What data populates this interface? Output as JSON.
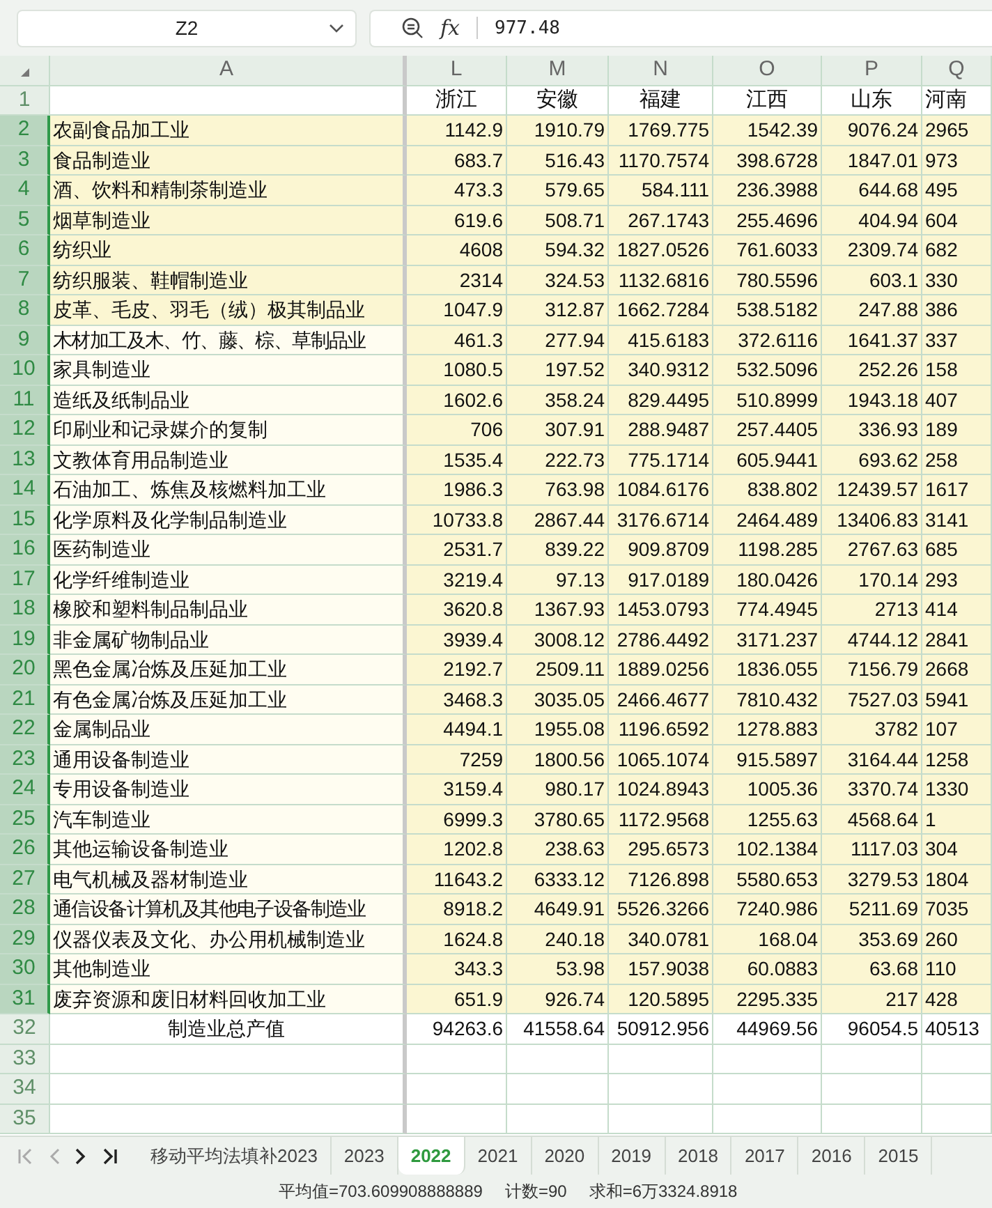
{
  "toolbar": {
    "name_box": "Z2",
    "function_label": "fx",
    "formula": "977.48"
  },
  "columns": [
    {
      "letter": "A",
      "selected": false
    },
    {
      "letter": "L",
      "selected": false
    },
    {
      "letter": "M",
      "selected": false
    },
    {
      "letter": "N",
      "selected": false
    },
    {
      "letter": "O",
      "selected": false
    },
    {
      "letter": "P",
      "selected": false
    },
    {
      "letter": "Q",
      "selected": false
    }
  ],
  "rows": [
    {
      "number": "1",
      "kind": "header",
      "selected": false,
      "values": [
        "浙江",
        "安徽",
        "福建",
        "江西",
        "山东",
        "河南"
      ]
    },
    {
      "number": "2",
      "kind": "data",
      "selected": true,
      "label_highlight": true,
      "label": "农副食品加工业",
      "values": [
        "1142.9",
        "1910.79",
        "1769.775",
        "1542.39",
        "9076.24",
        "2965"
      ]
    },
    {
      "number": "3",
      "kind": "data",
      "selected": true,
      "label_highlight": true,
      "label": "食品制造业",
      "values": [
        "683.7",
        "516.43",
        "1170.7574",
        "398.6728",
        "1847.01",
        "973"
      ]
    },
    {
      "number": "4",
      "kind": "data",
      "selected": true,
      "label_highlight": true,
      "label": "酒、饮料和精制茶制造业",
      "values": [
        "473.3",
        "579.65",
        "584.111",
        "236.3988",
        "644.68",
        "495"
      ]
    },
    {
      "number": "5",
      "kind": "data",
      "selected": true,
      "label_highlight": true,
      "label": "烟草制造业",
      "values": [
        "619.6",
        "508.71",
        "267.1743",
        "255.4696",
        "404.94",
        "604"
      ]
    },
    {
      "number": "6",
      "kind": "data",
      "selected": true,
      "label_highlight": true,
      "label": "纺织业",
      "values": [
        "4608",
        "594.32",
        "1827.0526",
        "761.6033",
        "2309.74",
        "682"
      ]
    },
    {
      "number": "7",
      "kind": "data",
      "selected": true,
      "label_highlight": true,
      "label": "纺织服装、鞋帽制造业",
      "values": [
        "2314",
        "324.53",
        "1132.6816",
        "780.5596",
        "603.1",
        "330"
      ]
    },
    {
      "number": "8",
      "kind": "data",
      "selected": true,
      "label_highlight": true,
      "label": "皮革、毛皮、羽毛（绒）极其制品业",
      "values": [
        "1047.9",
        "312.87",
        "1662.7284",
        "538.5182",
        "247.88",
        "386"
      ]
    },
    {
      "number": "9",
      "kind": "data",
      "selected": true,
      "label_highlight": false,
      "label": "木材加工及木、竹、藤、棕、草制品业",
      "values": [
        "461.3",
        "277.94",
        "415.6183",
        "372.6116",
        "1641.37",
        "337"
      ]
    },
    {
      "number": "10",
      "kind": "data",
      "selected": true,
      "label_highlight": false,
      "label": "家具制造业",
      "values": [
        "1080.5",
        "197.52",
        "340.9312",
        "532.5096",
        "252.26",
        "158"
      ]
    },
    {
      "number": "11",
      "kind": "data",
      "selected": true,
      "label_highlight": false,
      "label": "造纸及纸制品业",
      "values": [
        "1602.6",
        "358.24",
        "829.4495",
        "510.8999",
        "1943.18",
        "407"
      ]
    },
    {
      "number": "12",
      "kind": "data",
      "selected": true,
      "label_highlight": false,
      "label": "印刷业和记录媒介的复制",
      "values": [
        "706",
        "307.91",
        "288.9487",
        "257.4405",
        "336.93",
        "189"
      ]
    },
    {
      "number": "13",
      "kind": "data",
      "selected": true,
      "label_highlight": false,
      "label": "文教体育用品制造业",
      "values": [
        "1535.4",
        "222.73",
        "775.1714",
        "605.9441",
        "693.62",
        "258"
      ]
    },
    {
      "number": "14",
      "kind": "data",
      "selected": true,
      "label_highlight": false,
      "label": "石油加工、炼焦及核燃料加工业",
      "values": [
        "1986.3",
        "763.98",
        "1084.6176",
        "838.802",
        "12439.57",
        "1617"
      ]
    },
    {
      "number": "15",
      "kind": "data",
      "selected": true,
      "label_highlight": false,
      "label": "化学原料及化学制品制造业",
      "values": [
        "10733.8",
        "2867.44",
        "3176.6714",
        "2464.489",
        "13406.83",
        "3141"
      ]
    },
    {
      "number": "16",
      "kind": "data",
      "selected": true,
      "label_highlight": false,
      "label": "医药制造业",
      "values": [
        "2531.7",
        "839.22",
        "909.8709",
        "1198.285",
        "2767.63",
        "685"
      ]
    },
    {
      "number": "17",
      "kind": "data",
      "selected": true,
      "label_highlight": false,
      "label": "化学纤维制造业",
      "values": [
        "3219.4",
        "97.13",
        "917.0189",
        "180.0426",
        "170.14",
        "293"
      ]
    },
    {
      "number": "18",
      "kind": "data",
      "selected": true,
      "label_highlight": false,
      "label": "橡胶和塑料制品制品业",
      "values": [
        "3620.8",
        "1367.93",
        "1453.0793",
        "774.4945",
        "2713",
        "414"
      ]
    },
    {
      "number": "19",
      "kind": "data",
      "selected": true,
      "label_highlight": false,
      "label": "非金属矿物制品业",
      "values": [
        "3939.4",
        "3008.12",
        "2786.4492",
        "3171.237",
        "4744.12",
        "2841"
      ]
    },
    {
      "number": "20",
      "kind": "data",
      "selected": true,
      "label_highlight": false,
      "label": "黑色金属冶炼及压延加工业",
      "values": [
        "2192.7",
        "2509.11",
        "1889.0256",
        "1836.055",
        "7156.79",
        "2668"
      ]
    },
    {
      "number": "21",
      "kind": "data",
      "selected": true,
      "label_highlight": false,
      "label": "有色金属冶炼及压延加工业",
      "values": [
        "3468.3",
        "3035.05",
        "2466.4677",
        "7810.432",
        "7527.03",
        "5941"
      ]
    },
    {
      "number": "22",
      "kind": "data",
      "selected": true,
      "label_highlight": false,
      "label": "金属制品业",
      "values": [
        "4494.1",
        "1955.08",
        "1196.6592",
        "1278.883",
        "3782",
        "107"
      ]
    },
    {
      "number": "23",
      "kind": "data",
      "selected": true,
      "label_highlight": false,
      "label": "通用设备制造业",
      "values": [
        "7259",
        "1800.56",
        "1065.1074",
        "915.5897",
        "3164.44",
        "1258"
      ]
    },
    {
      "number": "24",
      "kind": "data",
      "selected": true,
      "label_highlight": false,
      "label": "专用设备制造业",
      "values": [
        "3159.4",
        "980.17",
        "1024.8943",
        "1005.36",
        "3370.74",
        "1330"
      ]
    },
    {
      "number": "25",
      "kind": "data",
      "selected": true,
      "label_highlight": false,
      "label": "汽车制造业",
      "values": [
        "6999.3",
        "3780.65",
        "1172.9568",
        "1255.63",
        "4568.64",
        "1"
      ]
    },
    {
      "number": "26",
      "kind": "data",
      "selected": true,
      "label_highlight": false,
      "label": "其他运输设备制造业",
      "values": [
        "1202.8",
        "238.63",
        "295.6573",
        "102.1384",
        "1117.03",
        "304"
      ]
    },
    {
      "number": "27",
      "kind": "data",
      "selected": true,
      "label_highlight": false,
      "label": "电气机械及器材制造业",
      "values": [
        "11643.2",
        "6333.12",
        "7126.898",
        "5580.653",
        "3279.53",
        "1804"
      ]
    },
    {
      "number": "28",
      "kind": "data",
      "selected": true,
      "label_highlight": false,
      "label": "通信设备计算机及其他电子设备制造业",
      "values": [
        "8918.2",
        "4649.91",
        "5526.3266",
        "7240.986",
        "5211.69",
        "7035"
      ]
    },
    {
      "number": "29",
      "kind": "data",
      "selected": true,
      "label_highlight": false,
      "label": "仪器仪表及文化、办公用机械制造业",
      "values": [
        "1624.8",
        "240.18",
        "340.0781",
        "168.04",
        "353.69",
        "260"
      ]
    },
    {
      "number": "30",
      "kind": "data",
      "selected": true,
      "label_highlight": false,
      "label": "其他制造业",
      "values": [
        "343.3",
        "53.98",
        "157.9038",
        "60.0883",
        "63.68",
        "110"
      ]
    },
    {
      "number": "31",
      "kind": "data",
      "selected": true,
      "label_highlight": false,
      "label": "废弃资源和废旧材料回收加工业",
      "values": [
        "651.9",
        "926.74",
        "120.5895",
        "2295.335",
        "217",
        "428"
      ]
    },
    {
      "number": "32",
      "kind": "total",
      "selected": false,
      "label": "制造业总产值",
      "values": [
        "94263.6",
        "41558.64",
        "50912.956",
        "44969.56",
        "96054.5",
        "40513"
      ]
    },
    {
      "number": "33",
      "kind": "empty",
      "selected": false
    },
    {
      "number": "34",
      "kind": "empty",
      "selected": false
    },
    {
      "number": "35",
      "kind": "empty",
      "selected": false
    }
  ],
  "sheet_tabs": [
    {
      "label": "移动平均法填补2023",
      "selected": false
    },
    {
      "label": "2023",
      "selected": false
    },
    {
      "label": "2022",
      "selected": true
    },
    {
      "label": "2021",
      "selected": false
    },
    {
      "label": "2020",
      "selected": false
    },
    {
      "label": "2019",
      "selected": false
    },
    {
      "label": "2018",
      "selected": false
    },
    {
      "label": "2017",
      "selected": false
    },
    {
      "label": "2016",
      "selected": false
    },
    {
      "label": "2015",
      "selected": false
    }
  ],
  "status_bar": [
    "平均值=703.609908888889",
    "计数=90",
    "求和=6万3324.8918"
  ]
}
